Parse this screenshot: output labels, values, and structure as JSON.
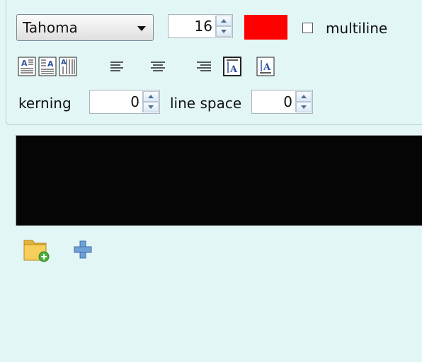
{
  "font": {
    "family": "Tahoma",
    "size": "16"
  },
  "color": {
    "value": "#ff0000"
  },
  "multiline": {
    "label": "multiline",
    "checked": false
  },
  "alignment_buttons": [
    "align-text-left-icon",
    "align-text-center-icon",
    "align-text-right-icon",
    "align-left-icon",
    "align-center-icon",
    "align-right-icon",
    "vertical-align-top-icon",
    "vertical-align-bottom-icon"
  ],
  "kerning": {
    "label": "kerning",
    "value": "0"
  },
  "line_space": {
    "label": "line space",
    "value": "0"
  },
  "preview": {
    "background": "#050505"
  },
  "bottom_icons": [
    "add-folder-icon",
    "add-icon"
  ]
}
